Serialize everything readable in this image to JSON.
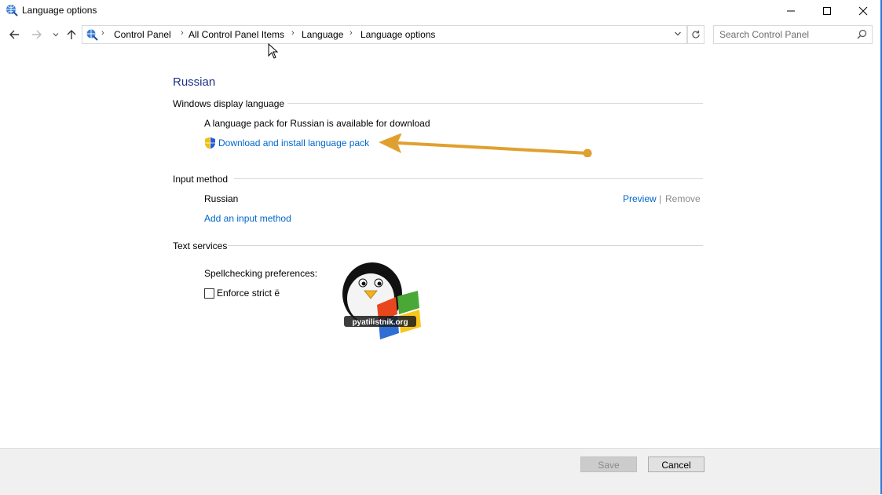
{
  "window": {
    "title": "Language options",
    "accent_color": "#2b79d8"
  },
  "nav": {
    "back_icon": "arrow-left-icon",
    "forward_icon": "arrow-right-icon",
    "recent_icon": "chevron-down-icon",
    "up_icon": "arrow-up-icon",
    "breadcrumbs": [
      "Control Panel",
      "All Control Panel Items",
      "Language",
      "Language options"
    ],
    "search_placeholder": "Search Control Panel"
  },
  "content": {
    "page_title": "Russian",
    "title_color": "#1e3287",
    "link_color": "#0066cc",
    "display_language": {
      "heading": "Windows display language",
      "message": "A language pack for Russian is available for download",
      "download_link": "Download and install language pack"
    },
    "input_method": {
      "heading": "Input method",
      "language": "Russian",
      "preview_link": "Preview",
      "separator": "|",
      "remove_link": "Remove",
      "add_link": "Add an input method"
    },
    "text_services": {
      "heading": "Text services",
      "spellcheck_label": "Spellchecking preferences:",
      "enforce_label": "Enforce strict ё",
      "enforce_checked": false
    },
    "logo_text": "pyatilistnik.org",
    "annotation_arrow_color": "#e0a030"
  },
  "footer": {
    "save_label": "Save",
    "save_enabled": false,
    "cancel_label": "Cancel"
  }
}
